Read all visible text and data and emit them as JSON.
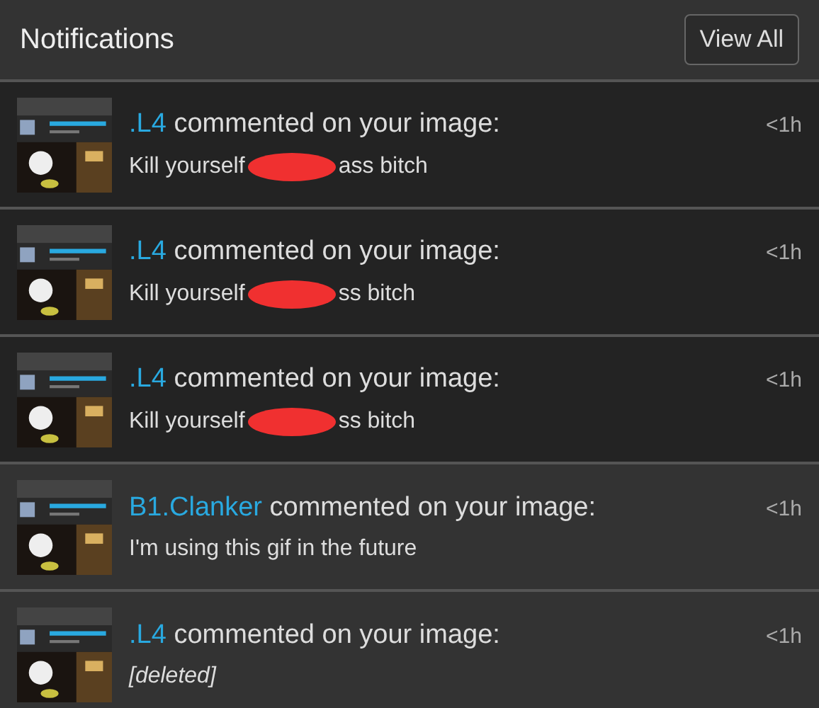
{
  "header": {
    "title": "Notifications",
    "button": "View All"
  },
  "notifications": [
    {
      "user": ".L4",
      "action": "commented on your image:",
      "time": "<1h",
      "highlighted": false,
      "comment": {
        "kind": "redacted",
        "before": "Kill yourself",
        "after": "ass bitch"
      }
    },
    {
      "user": ".L4",
      "action": "commented on your image:",
      "time": "<1h",
      "highlighted": false,
      "comment": {
        "kind": "redacted",
        "before": "Kill yourself",
        "after": "ss bitch"
      }
    },
    {
      "user": ".L4",
      "action": "commented on your image:",
      "time": "<1h",
      "highlighted": false,
      "comment": {
        "kind": "redacted",
        "before": "Kill yourself",
        "after": "ss bitch"
      }
    },
    {
      "user": "B1.Clanker",
      "action": "commented on your image:",
      "time": "<1h",
      "highlighted": true,
      "comment": {
        "kind": "text",
        "text": "I'm using this gif in the future"
      }
    },
    {
      "user": ".L4",
      "action": "commented on your image:",
      "time": "<1h",
      "highlighted": true,
      "comment": {
        "kind": "deleted",
        "text": "[deleted]"
      }
    }
  ]
}
